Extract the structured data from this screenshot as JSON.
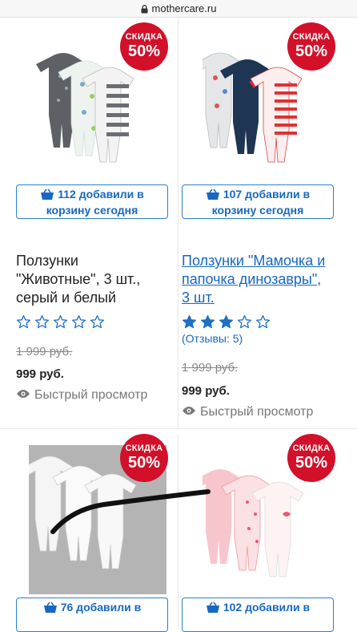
{
  "browser": {
    "url": "mothercare.ru"
  },
  "products": [
    {
      "badge_top": "СКИДКА",
      "badge_pct": "50%",
      "basket_line1": "112 добавили в",
      "basket_line2": "корзину сегодня",
      "title_lines": [
        "Ползунки",
        "\"Животные\", 3 шт.,",
        "серый и белый"
      ],
      "rating": 0,
      "reviews": "",
      "old_price": "1 999 руб.",
      "price": "999 руб.",
      "quick_view": "Быстрый просмотр"
    },
    {
      "badge_top": "СКИДКА",
      "badge_pct": "50%",
      "basket_line1": "107 добавили в",
      "basket_line2": "корзину сегодня",
      "title_lines": [
        "Ползунки \"Мамочка и",
        "папочка динозавры\",",
        "3 шт."
      ],
      "rating": 3,
      "reviews": "(Отзывы: 5)",
      "old_price": "1 999 руб.",
      "price": "999 руб.",
      "quick_view": "Быстрый просмотр"
    },
    {
      "badge_top": "СКИДКА",
      "badge_pct": "50%",
      "basket_line1": "76 добавили в",
      "basket_line2": ""
    },
    {
      "badge_top": "СКИДКА",
      "badge_pct": "50%",
      "basket_line1": "102 добавили в",
      "basket_line2": ""
    }
  ],
  "colors": {
    "badge": "#d2102a",
    "link": "#1768c2",
    "star": "#1f6fc5"
  },
  "icons": {
    "basket": "basket-icon",
    "eye": "eye-icon",
    "lock": "lock-icon",
    "star": "star-icon"
  }
}
